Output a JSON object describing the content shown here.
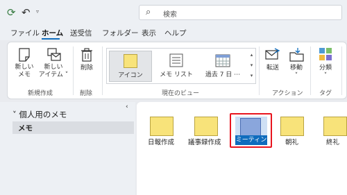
{
  "search": {
    "placeholder": "検索"
  },
  "menu": [
    "ファイル",
    "ホーム",
    "送受信",
    "フォルダー",
    "表示",
    "ヘルプ"
  ],
  "ribbon": {
    "new_note": "新しい\nメモ",
    "new_item": "新しい\nアイテム ˅",
    "delete": "削除",
    "view_icon": "アイコン",
    "view_list": "メモ リスト",
    "view_7days": "過去 7 日 ⋯",
    "forward": "転送",
    "move": "移動\n˅",
    "categorize": "分類\n˅",
    "groups": [
      "新規作成",
      "削除",
      "現在のビュー",
      "アクション",
      "タグ"
    ]
  },
  "sidebar": {
    "header": "個人用のメモ",
    "item": "メモ"
  },
  "notes": [
    "日報作成",
    "議事録作成",
    "ミーティング",
    "朝礼",
    "終礼"
  ],
  "colors": {
    "accent": "#0f6cbd",
    "note_yellow": "#f8e37a",
    "highlight": "#e8141e"
  }
}
